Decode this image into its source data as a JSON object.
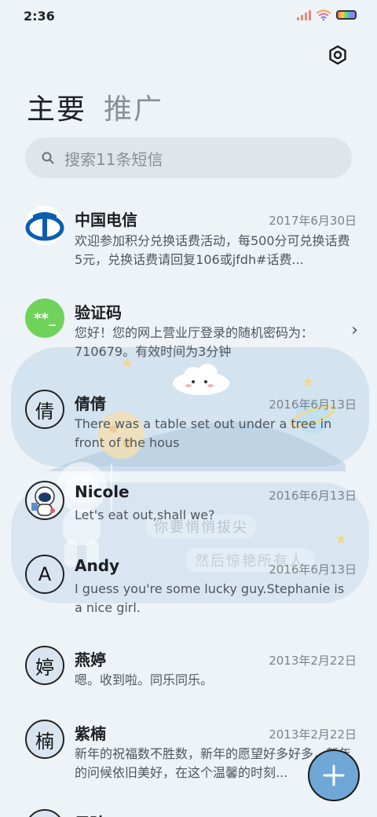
{
  "status": {
    "time": "2:36"
  },
  "tabs": [
    {
      "label": "主要"
    },
    {
      "label": "推广"
    }
  ],
  "search": {
    "placeholder": "搜索11条短信"
  },
  "decor": {
    "line1": "你要悄悄拔尖",
    "line2": "然后惊艳所有人"
  },
  "conversations": [
    {
      "name": "中国电信",
      "date": "2017年6月30日",
      "preview": "欢迎参加积分兑换话费活动，每500分可兑换话费5元，兑换话费请回复106或jfdh#话费...",
      "avatar": "china-telecom-logo"
    },
    {
      "name": "验证码",
      "date": "",
      "preview": "您好！您的网上营业厅登录的随机密码为：710679。有效时间为3分钟",
      "avatar_text": "**_"
    },
    {
      "name": "倩倩",
      "date": "2016年6月13日",
      "preview": "There was a table set out under a tree in front of the hous",
      "avatar_text": "倩"
    },
    {
      "name": "Nicole",
      "date": "2016年6月13日",
      "preview": "Let's eat out,shall we?",
      "avatar": "astronaut-photo"
    },
    {
      "name": "Andy",
      "date": "2016年6月13日",
      "preview": "I guess you're some lucky guy.Stephanie is a nice girl.",
      "avatar_text": "A"
    },
    {
      "name": "燕婷",
      "date": "2013年2月22日",
      "preview": "嗯。收到啦。同乐同乐。",
      "avatar_text": "婷"
    },
    {
      "name": "紫楠",
      "date": "2013年2月22日",
      "preview": "新年的祝福数不胜数，新年的愿望好多好多，新年的问候依旧美好，在这个温馨的时刻...",
      "avatar_text": "楠"
    },
    {
      "name": "子玲",
      "date": "",
      "preview": "",
      "avatar_text": "玲"
    }
  ],
  "fab": {
    "icon": "plus-icon"
  }
}
